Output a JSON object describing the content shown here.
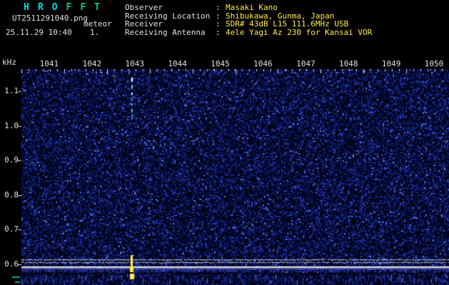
{
  "header": {
    "logo": {
      "letters": [
        {
          "ch": "H",
          "color": "#00dede"
        },
        {
          "ch": "R",
          "color": "#00dede"
        },
        {
          "ch": "O",
          "color": "#00dede"
        },
        {
          "ch": "F",
          "color": "#00cf87"
        },
        {
          "ch": "F",
          "color": "#00cf87"
        },
        {
          "ch": "T",
          "color": "#00cf87"
        }
      ]
    },
    "filename": "UT2511291040.png",
    "station": "meteor",
    "datetime": "25.11.29 10:40",
    "counter": "1.",
    "label_color": "#e2e2e2",
    "value_color": "#ffe94a",
    "info": [
      {
        "label": "Observer",
        "value": "Masaki Kano"
      },
      {
        "label": "Receiving Location",
        "value": "Shibukawa, Gunma, Japan"
      },
      {
        "label": "Receiver",
        "value": "SDR# 43dB L15 111.6MHz USB"
      },
      {
        "label": "Receiving Antenna",
        "value": "4ele Yagi Az 230 for Kansai VOR"
      }
    ]
  },
  "chart_data": {
    "type": "heatmap",
    "title": "HROFFT 10-minute radio meteor spectrogram",
    "grid": false,
    "legend": "none",
    "x": {
      "labels": [
        "1041",
        "1042",
        "1043",
        "1044",
        "1045",
        "1046",
        "1047",
        "1048",
        "1049",
        "1050"
      ],
      "start_ut": "10:41",
      "end_ut": "10:50"
    },
    "y": {
      "unit": "kHz",
      "tick_labels": [
        "1.1",
        "1.0",
        "0.9",
        "0.8",
        "0.7",
        "0.6"
      ],
      "tick_values": [
        1.1,
        1.0,
        0.9,
        0.8,
        0.7,
        0.6
      ],
      "top_khz": 1.164,
      "bottom_khz": 0.576
    },
    "echoes": [
      {
        "kind": "meteor-echo",
        "time_frac": 0.2588,
        "time_ut": "10:43",
        "freq_top_khz": 1.14,
        "freq_bottom_khz": 1.02,
        "color": "#9fe0ff"
      }
    ],
    "carrier_lines": [
      {
        "khz": 0.613,
        "color": "#e8e8e8",
        "width": 1,
        "broken": true
      },
      {
        "khz": 0.605,
        "color": "#c9c9e6",
        "width": 1,
        "broken": true
      },
      {
        "khz": 0.593,
        "color": "#f2f2f2",
        "width": 2,
        "broken": false
      },
      {
        "khz": 0.587,
        "color": "#9b8cff",
        "width": 1,
        "broken": false
      }
    ],
    "level_strip": {
      "spike": {
        "time_frac": 0.2588,
        "color": "#ffe832"
      },
      "noise_color": "#2338b0"
    },
    "colors": {
      "background": "#000000",
      "noise_dark": "#000212",
      "noise_mid": "#0a165c",
      "noise_bright": "#2640be",
      "tick": "#dcdcdc",
      "axis_text": "#e0e0e0",
      "scale_mark_cyan": "#00a8a8"
    }
  }
}
